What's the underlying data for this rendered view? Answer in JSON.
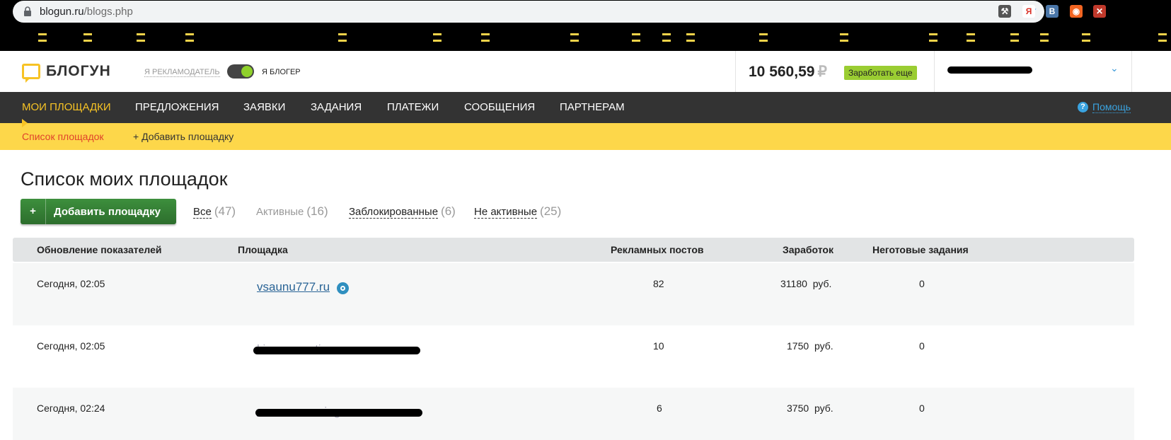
{
  "browser": {
    "url_host": "blogun.ru",
    "url_path": "/blogs.php",
    "extensions": [
      {
        "icon": "tool-icon",
        "glyph": "⚒",
        "color": "#555555"
      },
      {
        "icon": "yandex-icon",
        "glyph": "Я",
        "color": "#d93025"
      },
      {
        "icon": "vk-icon",
        "glyph": "В",
        "color": "#4a76a8"
      },
      {
        "icon": "rss-icon",
        "glyph": "◉",
        "color": "#f26522"
      },
      {
        "icon": "red-square-icon",
        "glyph": "✕",
        "color": "#c0392b"
      }
    ]
  },
  "header": {
    "logo_text": "БЛОГУН",
    "role_advertiser": "Я РЕКЛАМОДАТЕЛЬ",
    "role_blogger": "Я БЛОГЕР",
    "balance": "10 560,59",
    "currency": "₽",
    "earn_more": "Заработать еще"
  },
  "nav": {
    "items": [
      "МОИ ПЛОЩАДКИ",
      "ПРЕДЛОЖЕНИЯ",
      "ЗАЯВКИ",
      "ЗАДАНИЯ",
      "ПЛАТЕЖИ",
      "СООБЩЕНИЯ",
      "ПАРТНЕРАМ"
    ],
    "help": "Помощь",
    "help_glyph": "?"
  },
  "subnav": {
    "list": "Список площадок",
    "add": "+ Добавить площадку"
  },
  "page": {
    "title": "Список моих площадок",
    "add_button_plus": "+",
    "add_button": "Добавить площадку",
    "filters": [
      {
        "label": "Все",
        "count": "(47)"
      },
      {
        "label": "Активные",
        "count": "(16)"
      },
      {
        "label": "Заблокированные",
        "count": "(6)"
      },
      {
        "label": "Не активные",
        "count": "(25)"
      }
    ]
  },
  "table": {
    "headers": [
      "Обновление показателей",
      "Площадка",
      "Рекламных постов",
      "Заработок",
      "Неготовые задания"
    ],
    "rows": [
      {
        "updated": "Сегодня, 02:05",
        "site": "vsaunu777.ru",
        "posts": "82",
        "earnings": "31180",
        "unit": "руб.",
        "pending": "0"
      },
      {
        "updated": "Сегодня, 02:05",
        "site": "kino-novosti.ru",
        "posts": "10",
        "earnings": "1750",
        "unit": "руб.",
        "pending": "0"
      },
      {
        "updated": "Сегодня, 02:24",
        "site": "comesecrewing.ru",
        "posts": "6",
        "earnings": "3750",
        "unit": "руб.",
        "pending": "0"
      }
    ]
  }
}
